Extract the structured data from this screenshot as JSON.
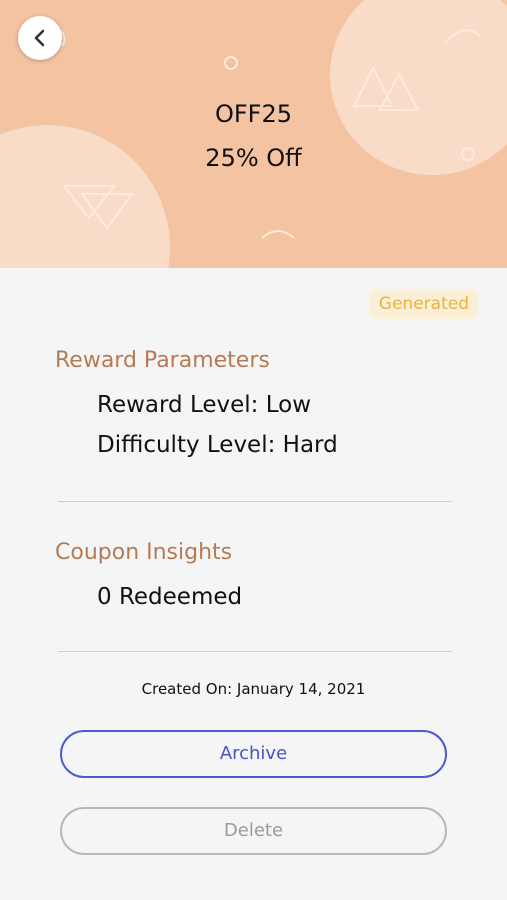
{
  "hero": {
    "coupon_code": "OFF25",
    "coupon_title": "25% Off",
    "background_color": "#f3c3a2"
  },
  "nav": {
    "back_icon": "chevron-left-icon"
  },
  "status": {
    "label": "Generated",
    "color": "#e8b33b"
  },
  "reward_parameters": {
    "title": "Reward Parameters",
    "reward_level": "Reward Level: Low",
    "difficulty_level": "Difficulty Level: Hard"
  },
  "coupon_insights": {
    "title": "Coupon Insights",
    "redeemed": "0 Redeemed"
  },
  "created_on": "Created On: January 14, 2021",
  "actions": {
    "archive_label": "Archive",
    "delete_label": "Delete"
  },
  "colors": {
    "accent": "#4554c6",
    "section_title": "#b47b56"
  }
}
